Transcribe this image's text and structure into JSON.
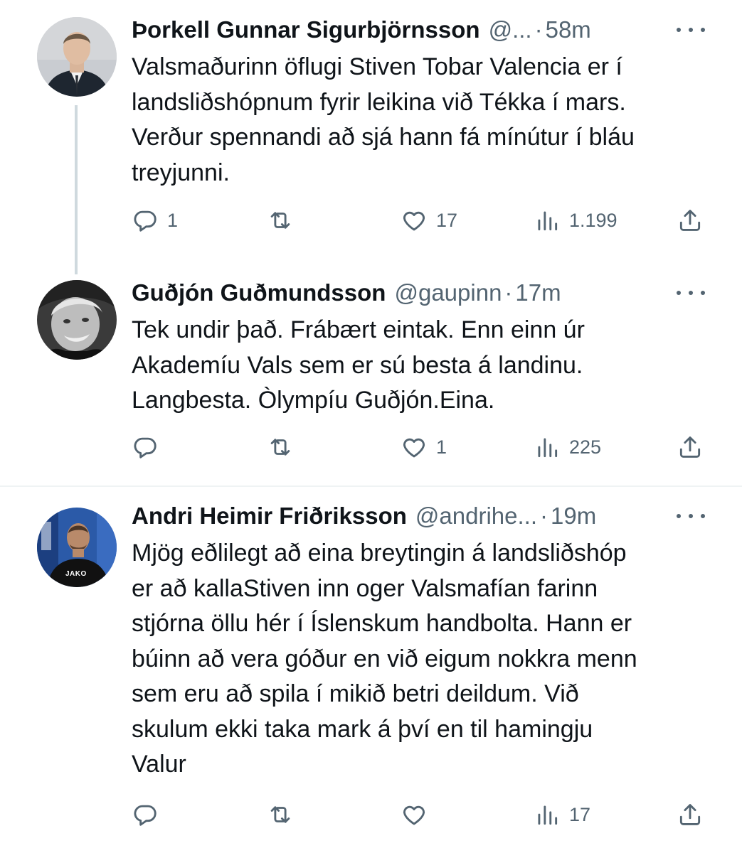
{
  "tweets": [
    {
      "author_name": "Þorkell Gunnar Sigurbjörnsson",
      "handle": "@...",
      "separator": "·",
      "time": "58m",
      "text": "Valsmaðurinn öflugi Stiven Tobar Valencia er í\nlandsliðshópnum fyrir leikina við Tékka í mars.\nVerður spennandi að sjá hann fá mínútur í bláu\ntreyjunni.",
      "replies": "1",
      "retweets": "",
      "likes": "17",
      "views": "1.199"
    },
    {
      "author_name": "Guðjón Guðmundsson",
      "handle": "@gaupinn",
      "separator": "·",
      "time": "17m",
      "text": "Tek undir það. Frábært eintak. Enn einn úr\nAkademíu Vals sem er sú besta á landinu.\nLangbesta. Òlympíu Guðjón.Eina.",
      "replies": "",
      "retweets": "",
      "likes": "1",
      "views": "225"
    },
    {
      "author_name": "Andri Heimir Friðriksson",
      "handle": "@andrihe...",
      "separator": "·",
      "time": "19m",
      "text": "Mjög eðlilegt að eina breytingin á landsliðshóp\ner að kallaStiven inn oger Valsmafían farinn\nstjórna öllu hér í Íslenskum handbolta. Hann er\nbúinn að vera góður en við eigum nokkra menn\nsem eru að spila í mikið betri deildum. Við\nskulum ekki taka mark á því en til hamingju\nValur",
      "replies": "",
      "retweets": "",
      "likes": "",
      "views": "17",
      "avatar_jersey_text": "JAKO"
    }
  ],
  "colors": {
    "text": "#0f1419",
    "secondary": "#536471",
    "thread_line": "#cfd9de",
    "divider": "#eff3f4"
  },
  "icons": {
    "reply": "reply-icon",
    "retweet": "retweet-icon",
    "like": "heart-icon",
    "views": "views-icon",
    "share": "share-icon",
    "more": "more-icon"
  }
}
